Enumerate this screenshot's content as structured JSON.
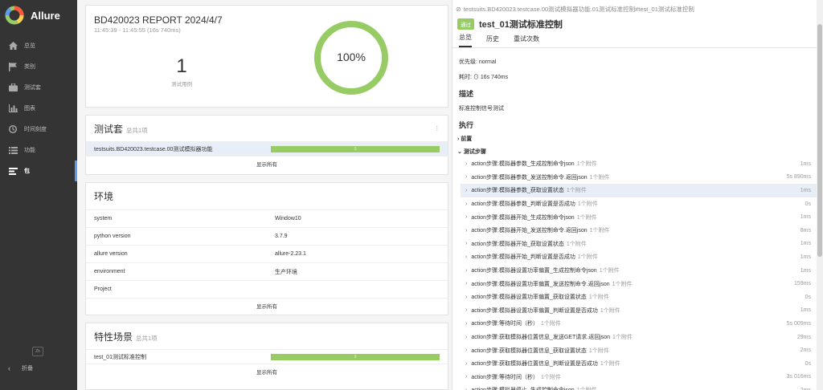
{
  "brand": {
    "name": "Allure"
  },
  "sidebar": {
    "items": [
      {
        "label": "总览",
        "icon": "home-icon"
      },
      {
        "label": "类别",
        "icon": "flag-icon"
      },
      {
        "label": "测试套",
        "icon": "briefcase-icon"
      },
      {
        "label": "图表",
        "icon": "bar-chart-icon"
      },
      {
        "label": "时间刻度",
        "icon": "clock-icon"
      },
      {
        "label": "功能",
        "icon": "list-icon"
      },
      {
        "label": "包",
        "icon": "packages-icon"
      }
    ],
    "lang": "Zh",
    "collapse_label": "折叠"
  },
  "summary": {
    "title": "BD420023 REPORT 2024/4/7",
    "time": "11:45:39 - 11:45:55 (16s 740ms)",
    "count": "1",
    "count_label": "测试用例",
    "percent": "100%",
    "pass_fraction": 1.0
  },
  "suites": {
    "title": "测试套",
    "subtitle": "总共1项",
    "rows": [
      {
        "name": "testsuits.BD420023.testcase.00测试模拟器功能",
        "count": "1"
      }
    ],
    "show_all": "显示所有"
  },
  "environment": {
    "title": "环境",
    "rows": [
      {
        "key": "system",
        "value": "Window10"
      },
      {
        "key": "python version",
        "value": "3.7.9"
      },
      {
        "key": "allure version",
        "value": "allure-2.23.1"
      },
      {
        "key": "environment",
        "value": "生产环境"
      },
      {
        "key": "Project",
        "value": ""
      }
    ],
    "show_all": "显示所有"
  },
  "features": {
    "title": "特性场景",
    "subtitle": "总共1项",
    "rows": [
      {
        "name": "test_01测试标准控制",
        "count": "1"
      }
    ],
    "show_all": "显示所有"
  },
  "detail": {
    "breadcrumb": "testsuits.BD420023.testcase.00测试模拟器功能.01测试标准控制#test_01测试标准控制",
    "status": "通过",
    "name": "test_01测试标准控制",
    "tabs": [
      "总览",
      "历史",
      "重试次数"
    ],
    "priority": "优先级: normal",
    "duration": "耗时: ⊙ 16s 740ms",
    "desc_title": "描述",
    "desc": "标准控制信号测试",
    "exec_title": "执行",
    "setup": "前置",
    "steps_title": "测试步骤",
    "steps": [
      {
        "name": "action步骤:模拟器参数_生成控制命令json",
        "att": "1个附件",
        "dur": "1ms"
      },
      {
        "name": "action步骤:模拟器参数_发送控制命令.返回json",
        "att": "1个附件",
        "dur": "5s 890ms"
      },
      {
        "name": "action步骤:模拟器参数_获取设置状态",
        "att": "1个附件",
        "dur": "1ms"
      },
      {
        "name": "action步骤:模拟器参数_判断设置是否成功",
        "att": "1个附件",
        "dur": "0s"
      },
      {
        "name": "action步骤:模拟器开始_生成控制命令json",
        "att": "1个附件",
        "dur": "1ms"
      },
      {
        "name": "action步骤:模拟器开始_发送控制命令.返回json",
        "att": "1个附件",
        "dur": "8ms"
      },
      {
        "name": "action步骤:模拟器开始_获取设置状态",
        "att": "1个附件",
        "dur": "1ms"
      },
      {
        "name": "action步骤:模拟器开始_判断设置是否成功",
        "att": "1个附件",
        "dur": "1ms"
      },
      {
        "name": "action步骤:模拟器设置功率偏置_生成控制命令json",
        "att": "1个附件",
        "dur": "1ms"
      },
      {
        "name": "action步骤:模拟器设置功率偏置_发送控制命令.返回json",
        "att": "1个附件",
        "dur": "159ms"
      },
      {
        "name": "action步骤:模拟器设置功率偏置_获取设置状态",
        "att": "1个附件",
        "dur": "0s"
      },
      {
        "name": "action步骤:模拟器设置功率偏置_判断设置是否成功",
        "att": "1个附件",
        "dur": "1ms"
      },
      {
        "name": "action步骤:等待时间（秒）",
        "att": "1个附件",
        "dur": "5s 009ms"
      },
      {
        "name": "action步骤:获取模拟器位置信息_发送GET请求.返回json",
        "att": "1个附件",
        "dur": "29ms"
      },
      {
        "name": "action步骤:获取模拟器位置信息_获取设置状态",
        "att": "1个附件",
        "dur": "2ms"
      },
      {
        "name": "action步骤:获取模拟器位置信息_判断设置是否成功",
        "att": "1个附件",
        "dur": "0s"
      },
      {
        "name": "action步骤:等待时间（秒）",
        "att": "1个附件",
        "dur": "3s 016ms"
      },
      {
        "name": "action步骤:模拟器停止_生成控制命令json",
        "att": "1个附件",
        "dur": "2ms"
      }
    ]
  },
  "colors": {
    "passed": "#97cc64",
    "sidebar": "#343434",
    "accent": "#5d9cec"
  }
}
